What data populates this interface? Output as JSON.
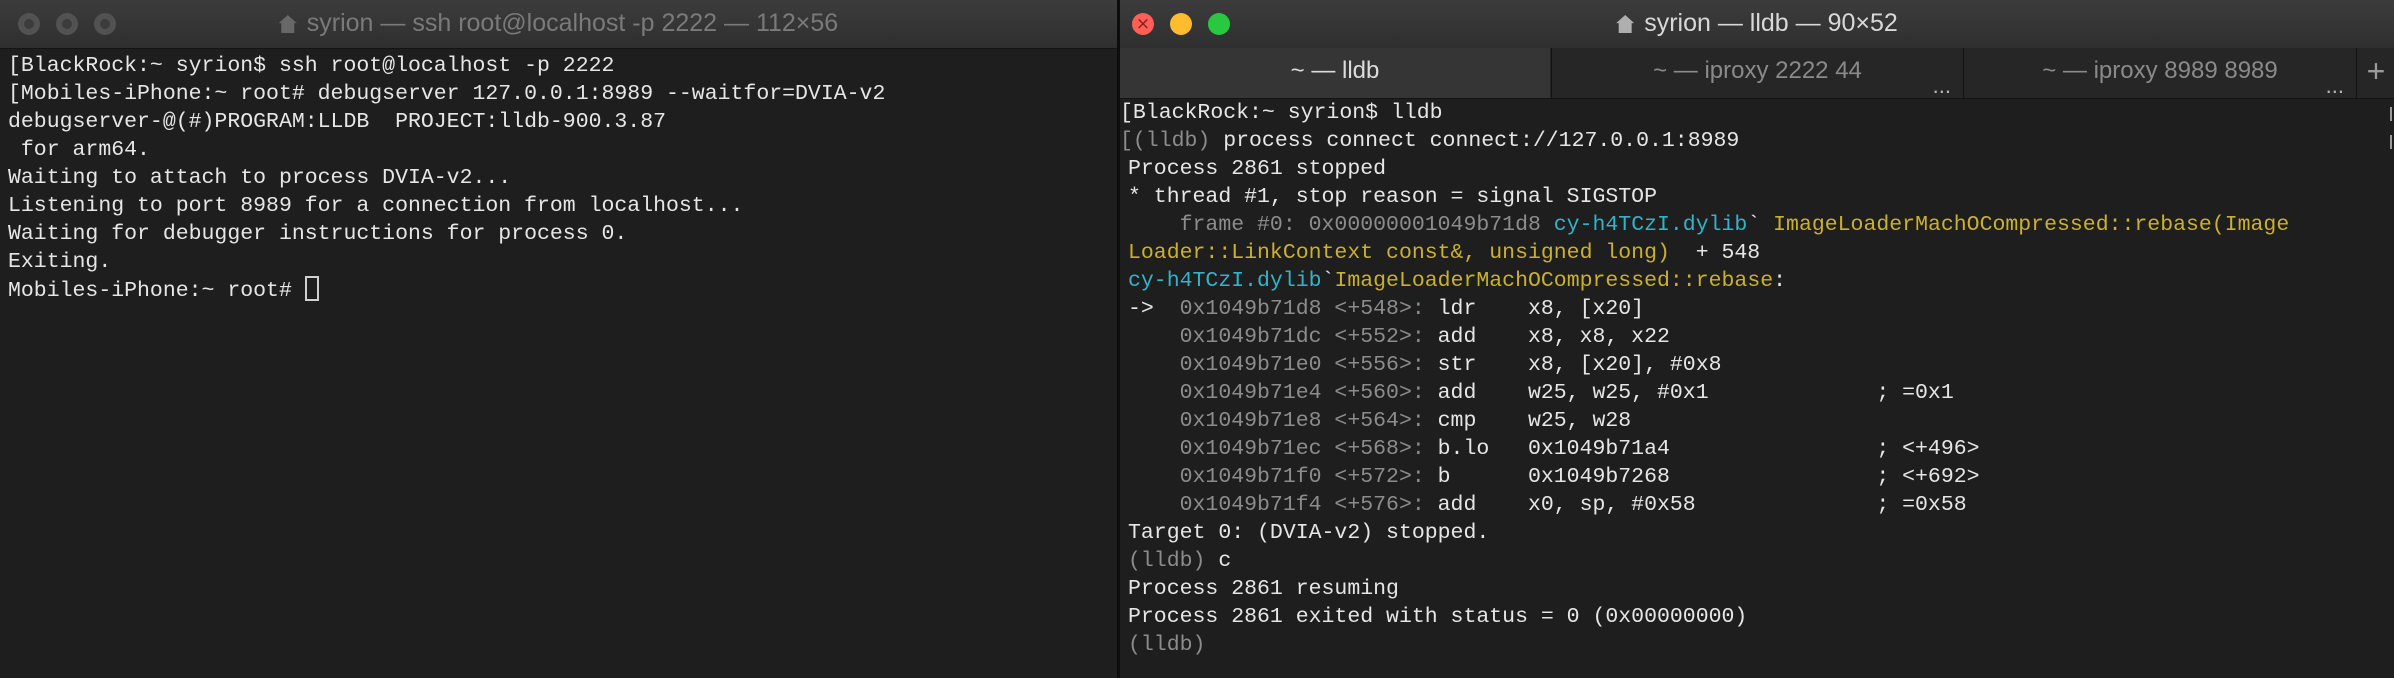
{
  "left_window": {
    "title": "syrion — ssh root@localhost -p 2222 — 112×56",
    "lines": [
      "[BlackRock:~ syrion$ ssh root@localhost -p 2222",
      "[Mobiles-iPhone:~ root# debugserver 127.0.0.1:8989 --waitfor=DVIA-v2",
      "debugserver-@(#)PROGRAM:LLDB  PROJECT:lldb-900.3.87",
      " for arm64.",
      "Waiting to attach to process DVIA-v2...",
      "Listening to port 8989 for a connection from localhost...",
      "Waiting for debugger instructions for process 0.",
      "Exiting.",
      "Mobiles-iPhone:~ root# "
    ]
  },
  "right_window": {
    "title": "syrion — lldb — 90×52",
    "tabs": [
      {
        "label": "~ — lldb",
        "active": true
      },
      {
        "label": "~ — iproxy 2222 44",
        "more": "..."
      },
      {
        "label": "~ — iproxy 8989 8989",
        "more": "..."
      }
    ],
    "add_tab": "+",
    "lines": {
      "l1": "[BlackRock:~ syrion$ lldb",
      "l2_prompt": "[(lldb) ",
      "l2_cmd": "process connect connect://127.0.0.1:8989",
      "l3": "Process 2861 stopped",
      "l4": "* thread #1, stop reason = signal SIGSTOP",
      "l5_frame": "    frame #0: 0x00000001049b71d8 ",
      "l5_lib": "cy-h4TCzI.dylib",
      "l5_tick": "` ",
      "l5_func": "ImageLoaderMachOCompressed::rebase(Image",
      "l6_func": "Loader::LinkContext const&, unsigned long)",
      "l6_rest": "  + 548",
      "l7_lib": "cy-h4TCzI.dylib",
      "l7_tick": "`",
      "l7_func": "ImageLoaderMachOCompressed::rebase",
      "l7_colon": ":",
      "l17": "Target 0: (DVIA-v2) stopped.",
      "l18_prompt": "(lldb) ",
      "l18_cmd": "c",
      "l19": "Process 2861 resuming",
      "l20": "Process 2861 exited with status = 0 (0x00000000)",
      "l21": "(lldb)"
    },
    "disasm": [
      {
        "arrow": "->  ",
        "addr": "0x1049b71d8 <+548>:",
        "code": " ldr    x8, [x20]"
      },
      {
        "arrow": "    ",
        "addr": "0x1049b71dc <+552>:",
        "code": " add    x8, x8, x22"
      },
      {
        "arrow": "    ",
        "addr": "0x1049b71e0 <+556>:",
        "code": " str    x8, [x20], #0x8"
      },
      {
        "arrow": "    ",
        "addr": "0x1049b71e4 <+560>:",
        "code": " add    w25, w25, #0x1             ; =0x1"
      },
      {
        "arrow": "    ",
        "addr": "0x1049b71e8 <+564>:",
        "code": " cmp    w25, w28"
      },
      {
        "arrow": "    ",
        "addr": "0x1049b71ec <+568>:",
        "code": " b.lo   0x1049b71a4                ; <+496>"
      },
      {
        "arrow": "    ",
        "addr": "0x1049b71f0 <+572>:",
        "code": " b      0x1049b7268                ; <+692>"
      },
      {
        "arrow": "    ",
        "addr": "0x1049b71f4 <+576>:",
        "code": " add    x0, sp, #0x58              ; =0x58"
      }
    ]
  },
  "colors": {
    "background": "#1e1e1e",
    "text": "#e6e6e6",
    "dim": "#8c8c8c",
    "cyan": "#2fb5c9",
    "yellow": "#c9b12d",
    "close": "#ff5f57",
    "minimize": "#febc2e",
    "zoom": "#28c840"
  },
  "icons": [
    "home-icon",
    "close-icon",
    "minimize-icon",
    "zoom-icon",
    "cursor-block"
  ]
}
